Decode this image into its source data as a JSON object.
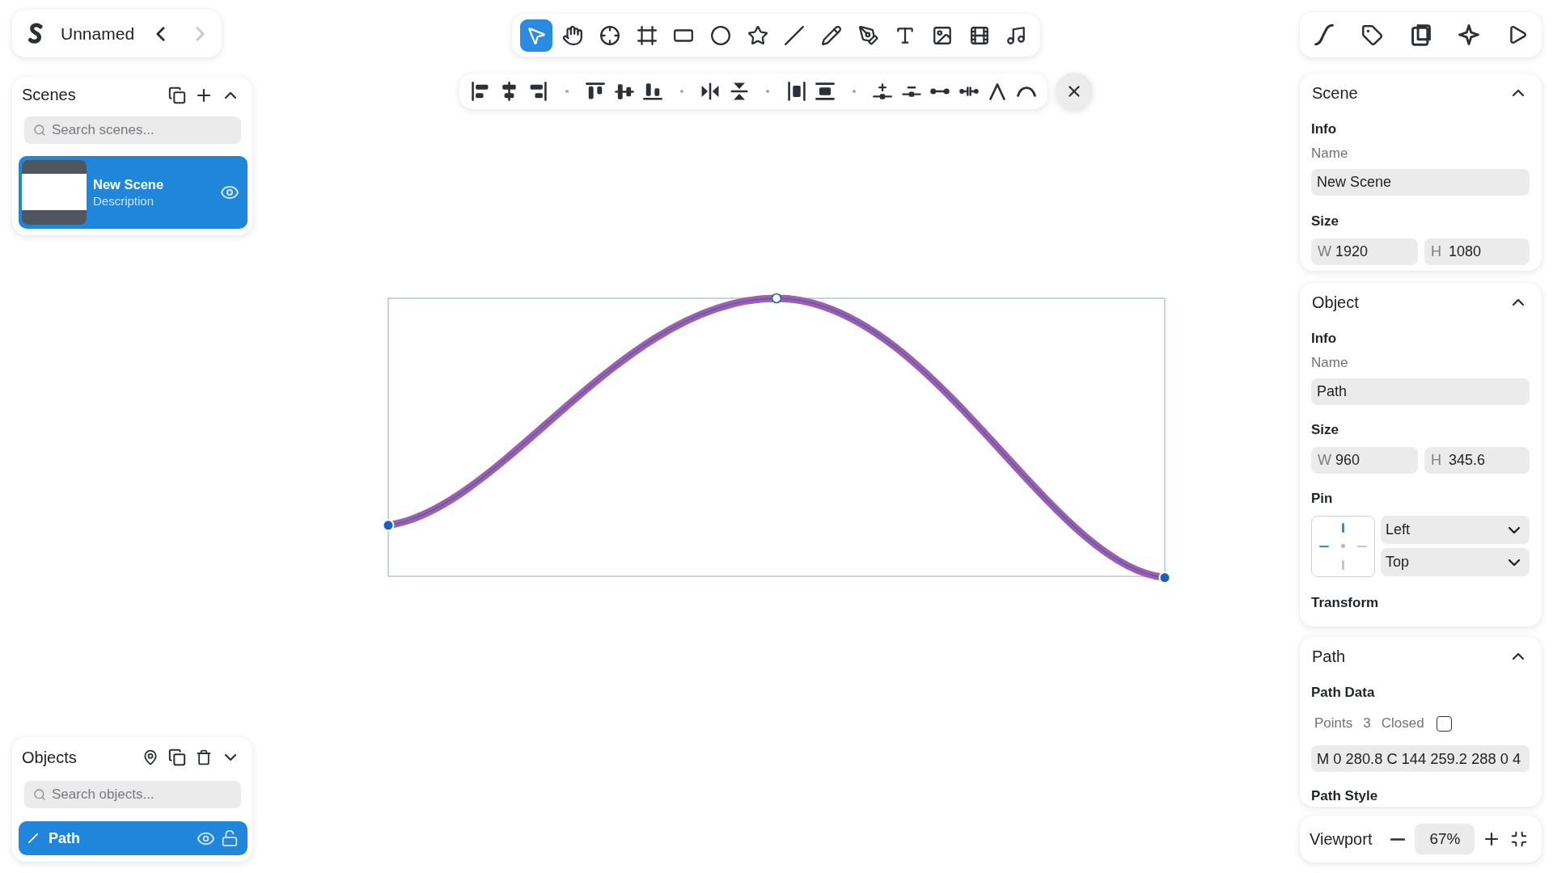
{
  "header": {
    "title": "Unnamed",
    "nav": [
      {
        "kind": "back",
        "disabled": false
      },
      {
        "kind": "forward",
        "disabled": true
      }
    ]
  },
  "toolbar": {
    "tools": [
      {
        "kind": "pointer",
        "selected": true
      },
      {
        "kind": "hand",
        "selected": false
      },
      {
        "kind": "crosshair",
        "selected": false
      },
      {
        "kind": "frame",
        "selected": false
      },
      {
        "kind": "rectangle",
        "selected": false
      },
      {
        "kind": "ellipse",
        "selected": false
      },
      {
        "kind": "star",
        "selected": false
      },
      {
        "kind": "line",
        "selected": false
      },
      {
        "kind": "pencil",
        "selected": false
      },
      {
        "kind": "pen",
        "selected": false
      },
      {
        "kind": "text",
        "selected": false
      },
      {
        "kind": "image",
        "selected": false
      },
      {
        "kind": "video",
        "selected": false
      },
      {
        "kind": "audio",
        "selected": false
      }
    ]
  },
  "scenes_panel": {
    "title": "Scenes",
    "search": {
      "placeholder": "Search scenes..."
    },
    "items": [
      {
        "name": "New Scene",
        "description": "Description",
        "selected": true,
        "visible": true
      }
    ]
  },
  "scene_panel": {
    "title": "Scene",
    "info_heading": "Info",
    "name_label": "Name",
    "name_value": "New Scene",
    "size_heading": "Size",
    "width": {
      "label": "W",
      "value": "1920"
    },
    "height": {
      "label": "H",
      "value": "1080"
    }
  },
  "object_panel": {
    "title": "Object",
    "info_heading": "Info",
    "name_label": "Name",
    "name_value": "Path",
    "size_heading": "Size",
    "width": {
      "label": "W",
      "value": "960"
    },
    "height": {
      "label": "H",
      "value": "345.6"
    },
    "pin": {
      "heading": "Pin",
      "sides": {
        "top": true,
        "right": false,
        "bottom": false,
        "left": true
      },
      "horizontal": "Left",
      "vertical": "Top"
    },
    "transform_heading": "Transform"
  },
  "path_panel": {
    "title": "Path",
    "data_heading": "Path Data",
    "points_label": "Points",
    "points_value": "3",
    "closed_label": "Closed",
    "closed": false,
    "path_data": "M 0 280.8 C 144 259.2 288 0 4",
    "style_heading": "Path Style"
  },
  "objects_panel": {
    "title": "Objects",
    "search": {
      "placeholder": "Search objects..."
    },
    "items": [
      {
        "name": "Path",
        "selected": true,
        "visible": true,
        "locked": false
      }
    ]
  },
  "viewport": {
    "label": "Viewport",
    "zoom": "67%"
  }
}
